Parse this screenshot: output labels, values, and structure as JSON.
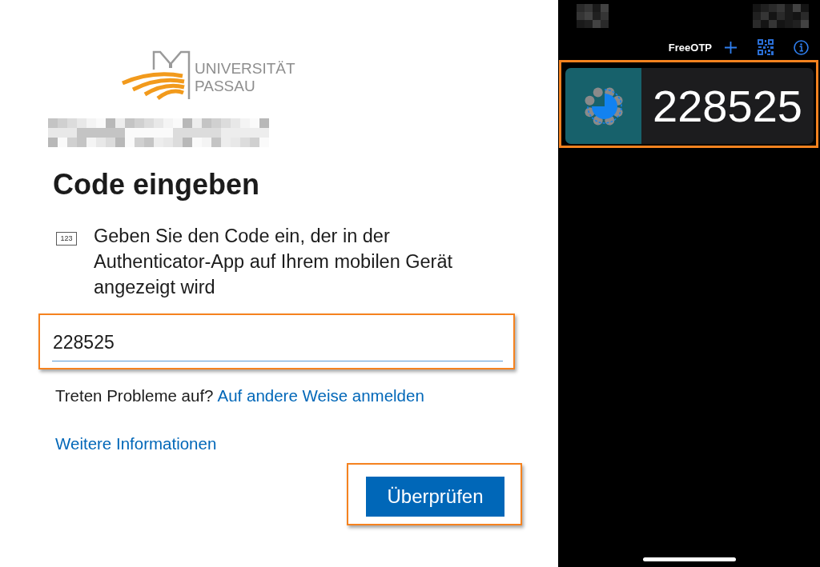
{
  "login": {
    "logo": {
      "lines": [
        "UNIVERSITÄT",
        "PASSAU"
      ]
    },
    "title": "Code eingeben",
    "instruction": {
      "icon_label": "123",
      "text": "Geben Sie den Code ein, der in der Authenticator-App auf Ihrem mobilen Gerät angezeigt wird"
    },
    "code_field": {
      "value": "228525",
      "highlighted": true
    },
    "help": {
      "text": "Treten Probleme auf?",
      "link": "Auf andere Weise anmelden"
    },
    "more_info_link": "Weitere Informationen",
    "verify_button": {
      "label": "Überprüfen",
      "highlighted": true
    }
  },
  "phone": {
    "app_bar": {
      "title": "FreeOTP"
    },
    "token": {
      "code": "228525",
      "highlighted": true
    }
  }
}
